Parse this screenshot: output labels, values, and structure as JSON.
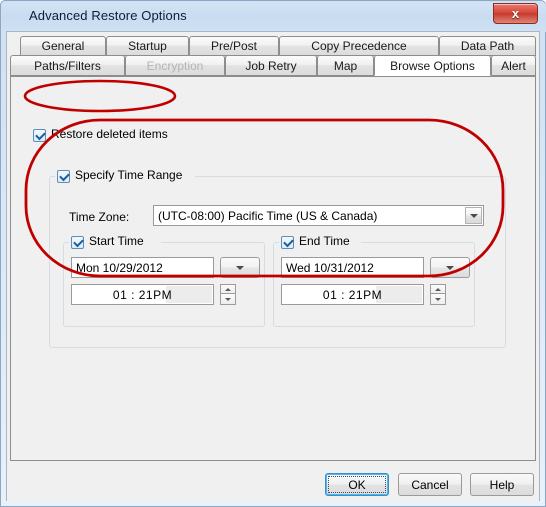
{
  "window": {
    "title": "Advanced Restore Options",
    "close_label": "x",
    "close_icon": "close-icon"
  },
  "tabs": {
    "row1": [
      {
        "label": "General",
        "state": "normal"
      },
      {
        "label": "Startup",
        "state": "normal"
      },
      {
        "label": "Pre/Post",
        "state": "normal"
      },
      {
        "label": "Copy Precedence",
        "state": "normal"
      },
      {
        "label": "Data Path",
        "state": "normal"
      }
    ],
    "row2": [
      {
        "label": "Paths/Filters",
        "state": "normal"
      },
      {
        "label": "Encryption",
        "state": "disabled"
      },
      {
        "label": "Job Retry",
        "state": "normal"
      },
      {
        "label": "Map",
        "state": "normal"
      },
      {
        "label": "Browse Options",
        "state": "active"
      },
      {
        "label": "Alert",
        "state": "normal"
      }
    ]
  },
  "browse_options": {
    "restore_deleted_items": {
      "label": "Restore deleted items",
      "checked": true
    },
    "specify_time_range": {
      "label": "Specify Time Range",
      "checked": true
    },
    "time_zone": {
      "label": "Time Zone:",
      "value": "(UTC-08:00) Pacific Time (US & Canada)"
    },
    "start_time": {
      "group_label": "Start Time",
      "checked": true,
      "date_value": "Mon 10/29/2012",
      "time_value": "01 : 21PM",
      "dropdown_icon": "chevron-down-icon",
      "spinner_icon": "spinner-updown-icon"
    },
    "end_time": {
      "group_label": "End Time",
      "checked": true,
      "date_value": "Wed 10/31/2012",
      "time_value": "01 : 21PM",
      "dropdown_icon": "chevron-down-icon",
      "spinner_icon": "spinner-updown-icon"
    }
  },
  "footer": {
    "ok_label": "OK",
    "cancel_label": "Cancel",
    "help_label": "Help"
  },
  "annotations": {
    "color": "#c00000",
    "ellipse_1_target": "Restore deleted items",
    "ellipse_2_target": "Specify Time Range"
  }
}
